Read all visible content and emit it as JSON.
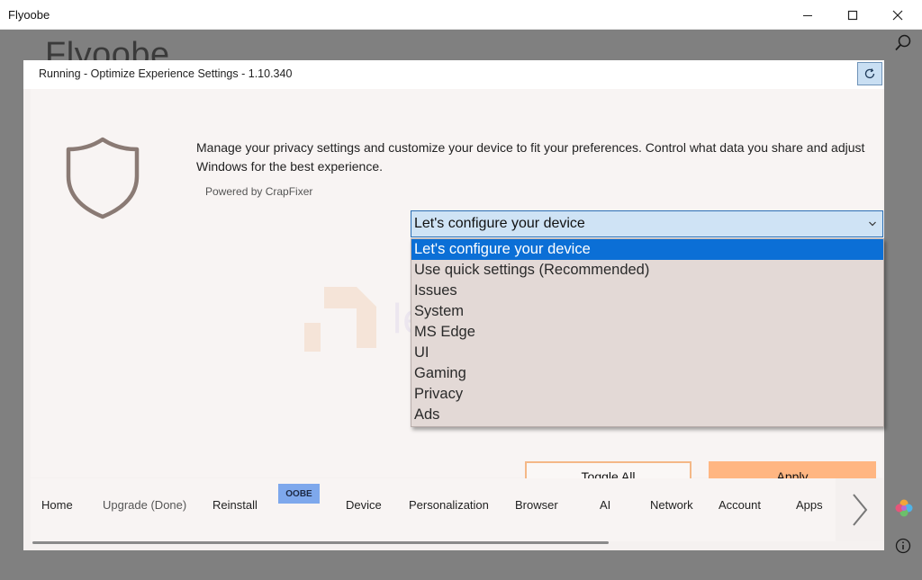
{
  "window": {
    "title": "Flyoobe",
    "background_title": "Flyoobe"
  },
  "dialog": {
    "title": "Running - Optimize Experience Settings - 1.10.340",
    "description": "Manage your privacy settings and customize your device to fit your preferences. Control what data you share and adjust Windows for the best experience.",
    "powered_by": "Powered by CrapFixer",
    "select": {
      "value": "Let's configure your device",
      "options": [
        "Let's configure your device",
        "Use quick settings (Recommended)",
        "Issues",
        "System",
        "MS Edge",
        "UI",
        "Gaming",
        "Privacy",
        "Ads"
      ],
      "selected_index": 0
    },
    "buttons": {
      "toggle_all": "Toggle All",
      "apply": "Apply"
    }
  },
  "nav": {
    "badge": "OOBE",
    "items": [
      "Home",
      "Upgrade (Done)",
      "Reinstall",
      "Device",
      "Personalization",
      "Browser",
      "AI",
      "Network",
      "Account",
      "Apps"
    ]
  },
  "watermark": "lerrabeinfo",
  "colors": {
    "accent": "#0b6fd6",
    "apply": "#ffb682",
    "toggle_border": "#f4b887",
    "badge": "#7ea8ec"
  }
}
